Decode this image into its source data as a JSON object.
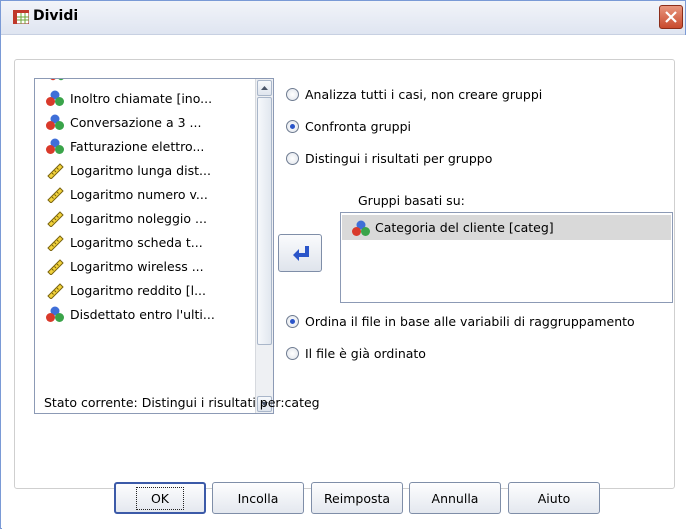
{
  "window": {
    "title": "Dividi"
  },
  "source_list": {
    "items": [
      {
        "label": "Inoltro chiamate [ino...",
        "icon": "nominal-icon"
      },
      {
        "label": "Conversazione a 3 ...",
        "icon": "nominal-icon"
      },
      {
        "label": "Fatturazione elettro...",
        "icon": "nominal-icon"
      },
      {
        "label": "Logaritmo lunga dist...",
        "icon": "scale-icon"
      },
      {
        "label": "Logaritmo numero v...",
        "icon": "scale-icon"
      },
      {
        "label": "Logaritmo noleggio ...",
        "icon": "scale-icon"
      },
      {
        "label": "Logaritmo scheda t...",
        "icon": "scale-icon"
      },
      {
        "label": "Logaritmo wireless ...",
        "icon": "scale-icon"
      },
      {
        "label": "Logaritmo reddito [l...",
        "icon": "scale-icon"
      },
      {
        "label": "Disdettato entro l'ulti...",
        "icon": "nominal-icon"
      }
    ]
  },
  "options": {
    "analyze_all": {
      "label": "Analizza tutti i casi, non creare gruppi",
      "selected": false
    },
    "compare_groups": {
      "label": "Confronta gruppi",
      "selected": true
    },
    "separate_output": {
      "label": "Distingui i risultati per gruppo",
      "selected": false
    }
  },
  "groups_based_on": {
    "label": "Gruppi basati su:",
    "items": [
      {
        "label": "Categoria del cliente [categ]",
        "icon": "nominal-icon"
      }
    ]
  },
  "sort_options": {
    "sort_file": {
      "label": "Ordina il file in base alle variabili di raggruppamento",
      "selected": true
    },
    "already_sorted": {
      "label": "Il file è già ordinato",
      "selected": false
    }
  },
  "status": {
    "text": "Stato corrente: Distingui i risultati per:categ"
  },
  "buttons": {
    "ok": "OK",
    "paste": "Incolla",
    "reset": "Reimposta",
    "cancel": "Annulla",
    "help": "Aiuto"
  },
  "colors": {
    "accent": "#2b55c9",
    "selection": "#d9d9d9",
    "close": "#c94a2e"
  }
}
